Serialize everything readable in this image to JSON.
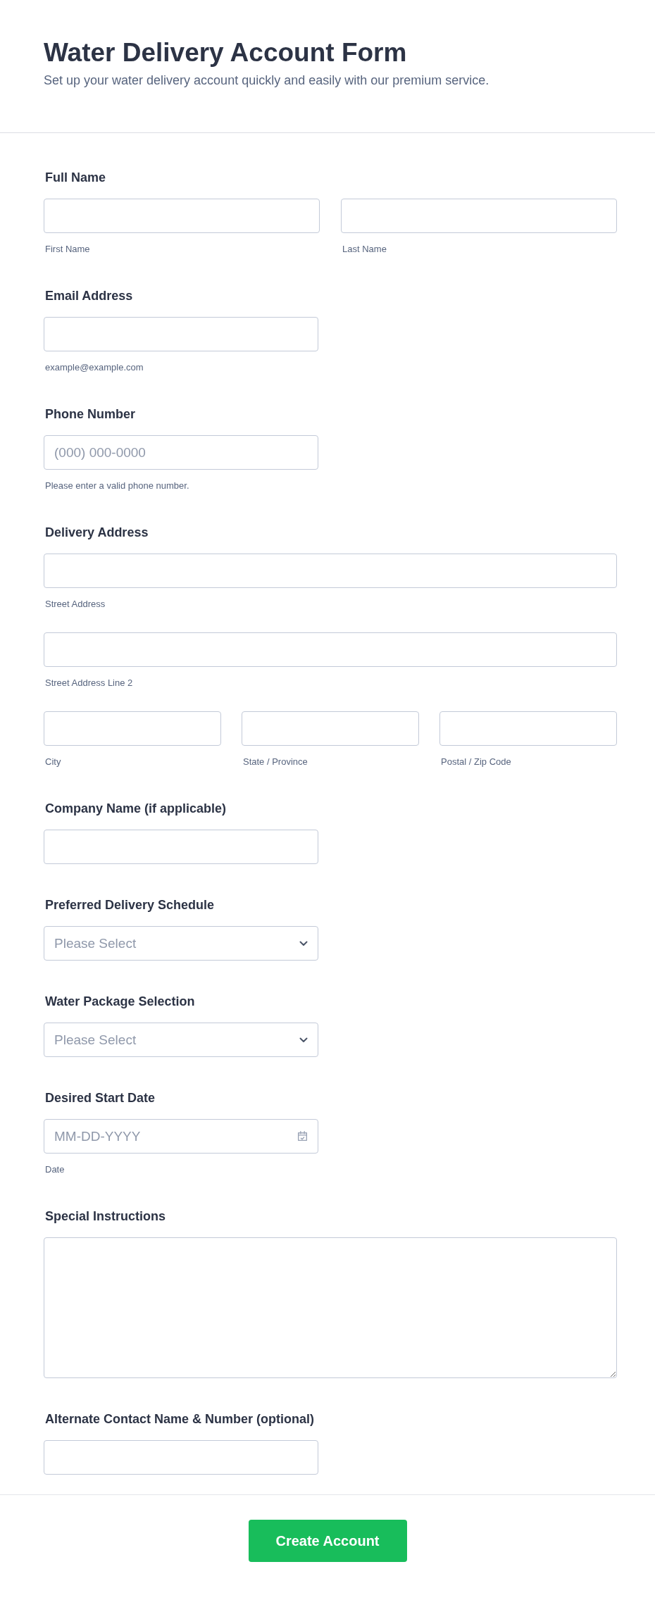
{
  "header": {
    "title": "Water Delivery Account Form",
    "subtitle": "Set up your water delivery account quickly and easily with our premium service."
  },
  "fields": [
    {
      "kind": "name",
      "label": "Full Name",
      "parts": [
        {
          "sublabel": "First Name"
        },
        {
          "sublabel": "Last Name"
        }
      ]
    },
    {
      "kind": "short",
      "label": "Email Address",
      "sublabel": "example@example.com"
    },
    {
      "kind": "short",
      "label": "Phone Number",
      "placeholder": "(000) 000-0000",
      "sublabel": "Please enter a valid phone number."
    },
    {
      "kind": "address",
      "label": "Delivery Address",
      "rows": [
        [
          {
            "sublabel": "Street Address"
          }
        ],
        [
          {
            "sublabel": "Street Address Line 2"
          }
        ],
        [
          {
            "sublabel": "City"
          },
          {
            "sublabel": "State / Province"
          },
          {
            "sublabel": "Postal / Zip Code"
          }
        ]
      ]
    },
    {
      "kind": "short",
      "label": "Company Name (if applicable)"
    },
    {
      "kind": "dropdown",
      "label": "Preferred Delivery Schedule",
      "placeholder": "Please Select"
    },
    {
      "kind": "dropdown",
      "label": "Water Package Selection",
      "placeholder": "Please Select"
    },
    {
      "kind": "date",
      "label": "Desired Start Date",
      "placeholder": "MM-DD-YYYY",
      "sublabel": "Date"
    },
    {
      "kind": "textarea",
      "label": "Special Instructions"
    },
    {
      "kind": "short",
      "label": "Alternate Contact Name & Number (optional)"
    }
  ],
  "submit": {
    "label": "Create Account"
  }
}
